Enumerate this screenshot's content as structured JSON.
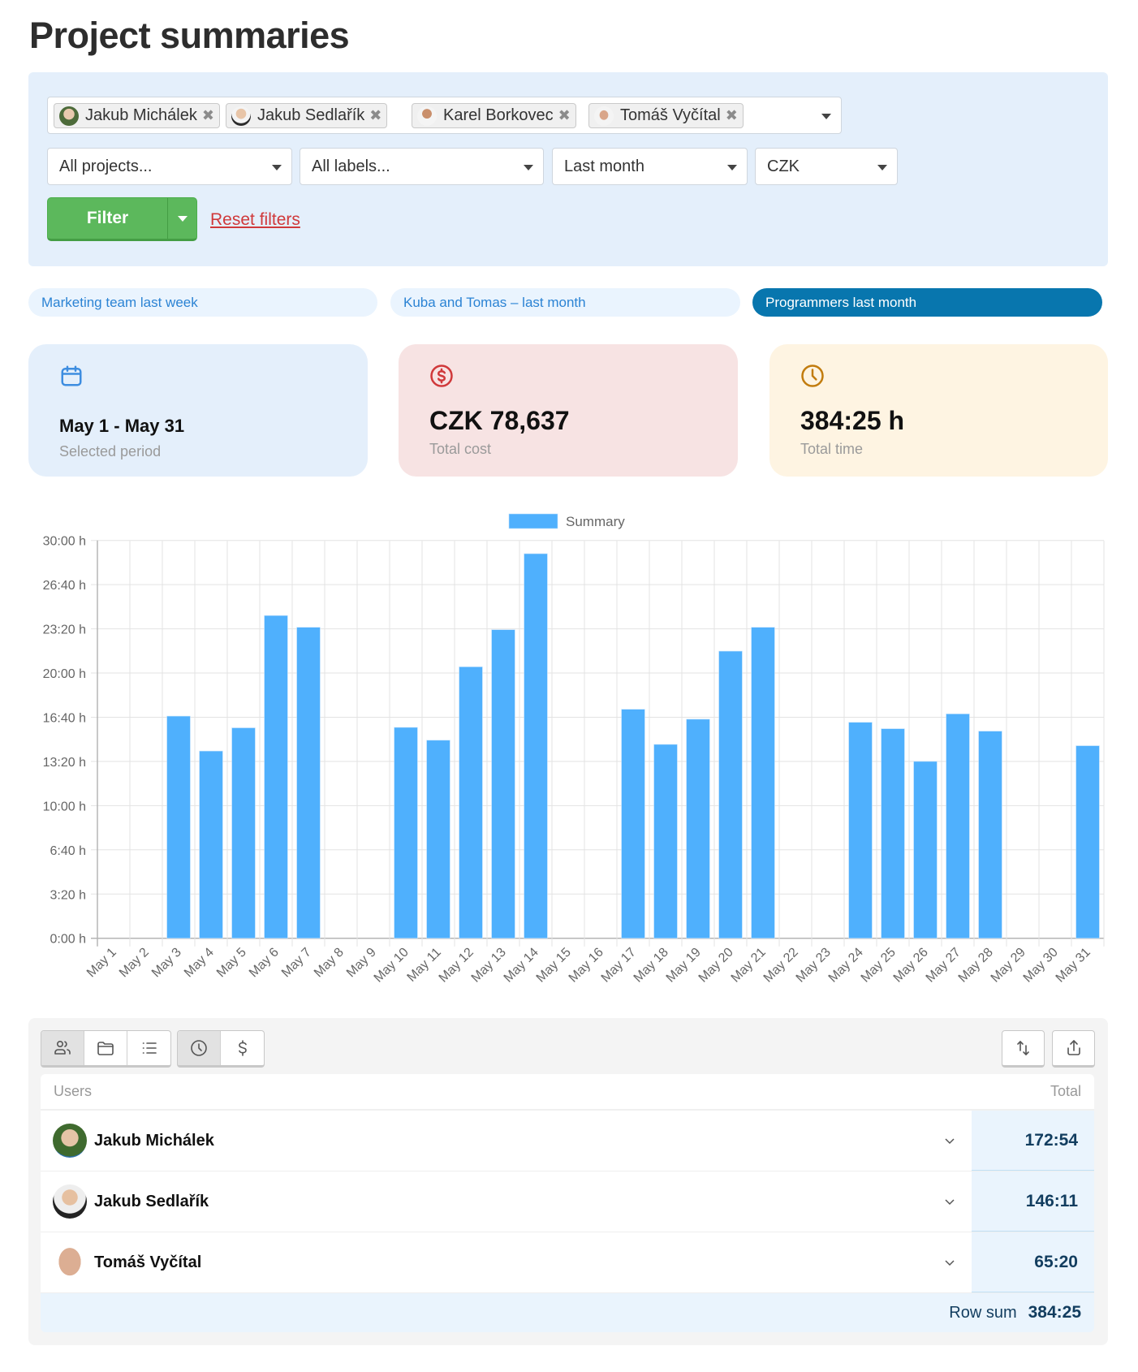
{
  "page": {
    "title": "Project summaries"
  },
  "filters": {
    "users": [
      {
        "name": "Jakub Michálek",
        "avatar_color": "#4d6b3a"
      },
      {
        "name": "Jakub Sedlařík",
        "avatar_color": "#2b2b2b"
      },
      {
        "name": "Karel Borkovec",
        "avatar_color": "#c98f6b"
      },
      {
        "name": "Tomáš Vyčítal",
        "avatar_color": "#b47a5a"
      }
    ],
    "remove_glyph": "✖",
    "projects": "All projects...",
    "labels": "All labels...",
    "period": "Last month",
    "currency": "CZK",
    "filter_label": "Filter",
    "reset_label": "Reset filters"
  },
  "saved_filters": [
    {
      "label": "Marketing team last week",
      "active": false
    },
    {
      "label": "Kuba and Tomas – last month",
      "active": false
    },
    {
      "label": "Programmers last month",
      "active": true
    }
  ],
  "cards": {
    "period": {
      "icon": "calendar-icon",
      "value": "May 1 - May 31",
      "label": "Selected period",
      "color": "#3d8de0"
    },
    "cost": {
      "icon": "dollar-circle-icon",
      "value": "CZK 78,637",
      "label": "Total cost",
      "color": "#d0393b"
    },
    "time": {
      "icon": "clock-icon",
      "value": "384:25 h",
      "label": "Total time",
      "color": "#c27c0e"
    }
  },
  "chart_data": {
    "type": "bar",
    "title": "",
    "legend": [
      "Summary"
    ],
    "legend_position": "top",
    "bar_color": "#4fb0fd",
    "xlabel": "",
    "ylabel": "",
    "grid": true,
    "ylim_minutes": [
      0,
      1800
    ],
    "y_ticks": [
      "0:00 h",
      "3:20 h",
      "6:40 h",
      "10:00 h",
      "13:20 h",
      "16:40 h",
      "20:00 h",
      "23:20 h",
      "26:40 h",
      "30:00 h"
    ],
    "categories": [
      "May 1",
      "May 2",
      "May 3",
      "May 4",
      "May 5",
      "May 6",
      "May 7",
      "May 8",
      "May 9",
      "May 10",
      "May 11",
      "May 12",
      "May 13",
      "May 14",
      "May 15",
      "May 16",
      "May 17",
      "May 18",
      "May 19",
      "May 20",
      "May 21",
      "May 22",
      "May 23",
      "May 24",
      "May 25",
      "May 26",
      "May 27",
      "May 28",
      "May 29",
      "May 30",
      "May 31"
    ],
    "series": [
      {
        "name": "Summary",
        "unit": "minutes",
        "values": [
          0,
          0,
          1005,
          847,
          952,
          1460,
          1407,
          0,
          0,
          954,
          896,
          1228,
          1396,
          1740,
          0,
          0,
          1036,
          877,
          991,
          1299,
          1407,
          0,
          0,
          977,
          948,
          800,
          1015,
          937,
          0,
          0,
          871
        ]
      }
    ]
  },
  "table": {
    "toolbar": {
      "group_by": [
        {
          "icon": "users-icon",
          "active": true
        },
        {
          "icon": "folder-icon",
          "active": false
        },
        {
          "icon": "list-icon",
          "active": false
        }
      ],
      "metric": [
        {
          "icon": "clock-icon",
          "active": true
        },
        {
          "icon": "dollar-icon",
          "active": false
        }
      ],
      "sort_icon": "sort-arrows-icon",
      "export_icon": "share-export-icon"
    },
    "header": {
      "col1": "Users",
      "col2": "Total"
    },
    "rows": [
      {
        "name": "Jakub Michálek",
        "total": "172:54",
        "avatar_color": "#4d6b3a"
      },
      {
        "name": "Jakub Sedlařík",
        "total": "146:11",
        "avatar_color": "#2b2b2b"
      },
      {
        "name": "Tomáš Vyčítal",
        "total": "65:20",
        "avatar_color": "#b47a5a"
      }
    ],
    "footer": {
      "label": "Row sum",
      "sum": "384:25"
    }
  }
}
